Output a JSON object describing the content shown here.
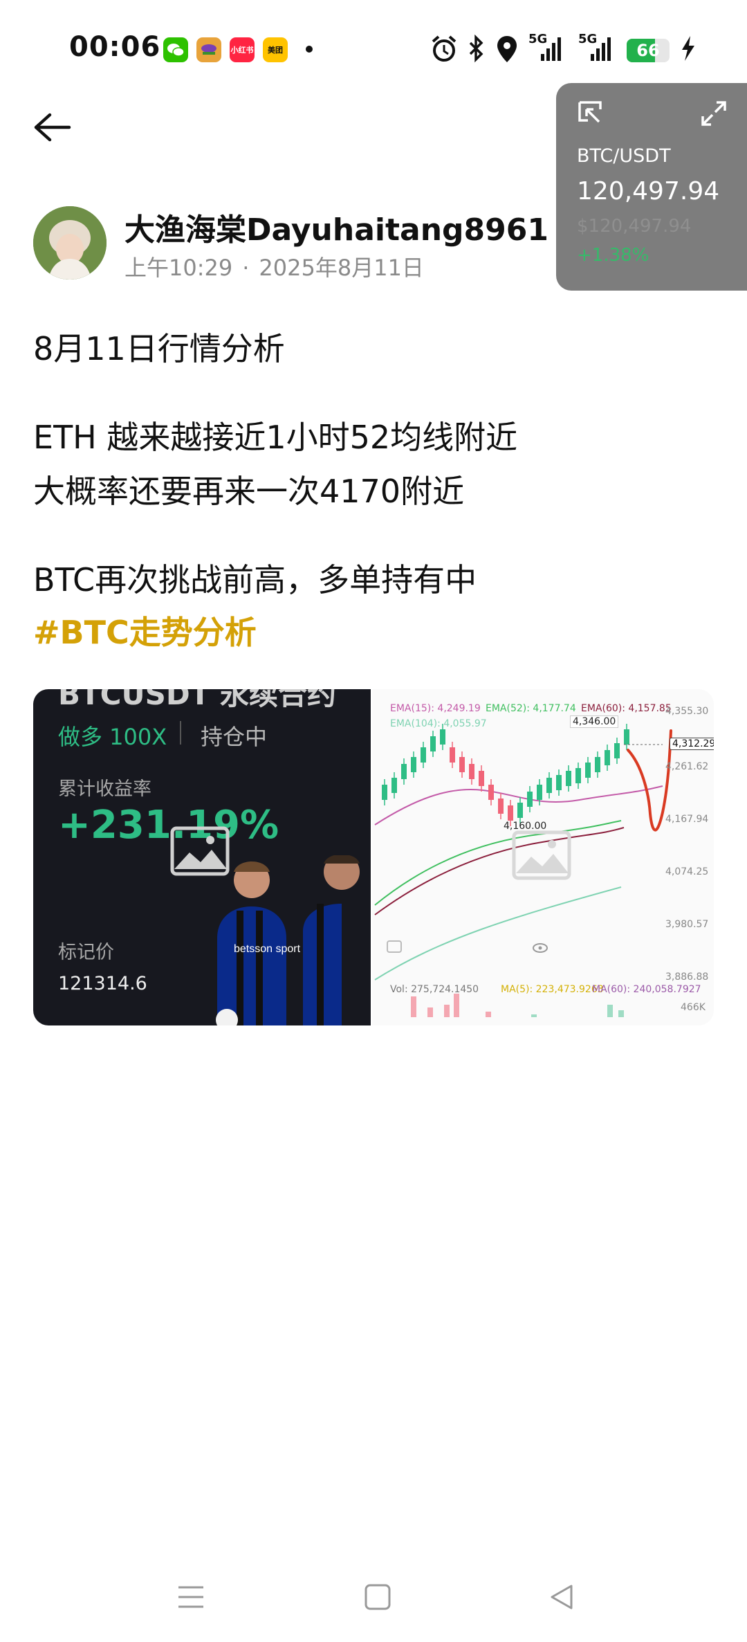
{
  "status_bar": {
    "time": "00:06",
    "apps": [
      {
        "name": "wechat-icon",
        "color": "#2dc100"
      },
      {
        "name": "game-app-icon",
        "color": "#e8a33b"
      },
      {
        "name": "xiaohongshu-icon",
        "color": "#ff2442",
        "label": "小红书"
      },
      {
        "name": "meituan-icon",
        "color": "#ffc300",
        "label": "美团"
      }
    ],
    "network_1": "5G",
    "network_2": "5G",
    "battery": "66"
  },
  "widget": {
    "pair": "BTC/USDT",
    "price": "120,497.94",
    "usd_price": "$120,497.94",
    "change": "+1.38%"
  },
  "post": {
    "author": "大渔海棠Dayuhaitang8961",
    "time": "上午10:29",
    "separator": "·",
    "date": "2025年8月11日",
    "line1": "8月11日行情分析",
    "line2": "ETH  越来越接近1小时52均线附近",
    "line3": "大概率还要再来一次4170附近",
    "line4": "BTC再次挑战前高，多单持有中",
    "hashtag": "#BTC走势分析"
  },
  "image1": {
    "top_cut": "BTCUSDT 永续合约",
    "position": "做多 100X",
    "status": "持仓中",
    "label_return": "累计收益率",
    "return_value": "+231.19%",
    "label_mark": "标记价",
    "mark_price": "121314.6",
    "sponsor": "betsson sport"
  },
  "image2": {
    "ema15": "EMA(15): 4,249.19",
    "ema52": "EMA(52): 4,177.74",
    "ema60": "EMA(60): 4,157.85",
    "ema104": "EMA(104): 4,055.97",
    "high_label": "4,346.00",
    "low_label": "4,160.00",
    "current_price": "4,312.29",
    "price_axis": [
      "4,355.30",
      "4,261.62",
      "4,167.94",
      "4,074.25",
      "3,980.57",
      "3,886.88"
    ],
    "vol": "Vol: 275,724.1450",
    "ma5": "MA(5): 223,473.9263",
    "ma60": "MA(60): 240,058.7927",
    "vol_axis": "466K",
    "colors": {
      "ema15": "#c35aa8",
      "ema52": "#3fbf5f",
      "ema60": "#8b1f3c",
      "ema104": "#7fd3b2",
      "up": "#2ebd85",
      "down": "#f06478"
    }
  }
}
